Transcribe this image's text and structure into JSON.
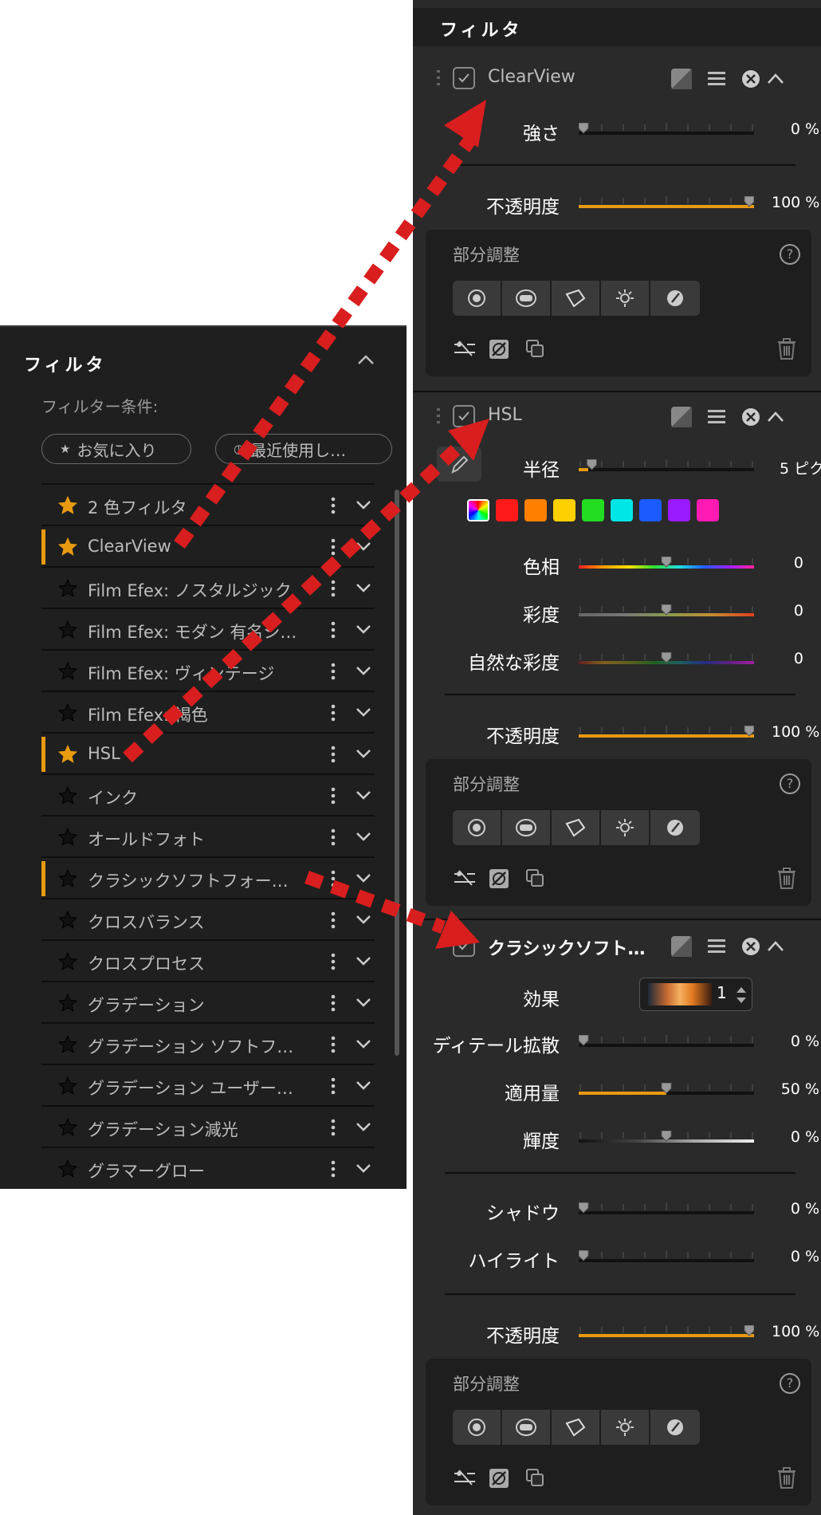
{
  "left": {
    "title": "フィルタ",
    "filter_condition": "フィルター条件:",
    "pill_favorites": "お気に入り",
    "pill_recent": "最近使用し…",
    "items": [
      {
        "label": "2 色フィルタ",
        "fav": true,
        "selected": false
      },
      {
        "label": "ClearView",
        "fav": true,
        "selected": true
      },
      {
        "label": "Film Efex: ノスタルジック",
        "fav": false,
        "selected": false
      },
      {
        "label": "Film Efex: モダン 有名シ…",
        "fav": false,
        "selected": false
      },
      {
        "label": "Film Efex: ヴィンテージ",
        "fav": false,
        "selected": false
      },
      {
        "label": "Film Efex: 褐色",
        "fav": false,
        "selected": false
      },
      {
        "label": "HSL",
        "fav": true,
        "selected": true
      },
      {
        "label": "インク",
        "fav": false,
        "selected": false
      },
      {
        "label": "オールドフォト",
        "fav": false,
        "selected": false
      },
      {
        "label": "クラシックソフトフォー…",
        "fav": false,
        "selected": true
      },
      {
        "label": "クロスバランス",
        "fav": false,
        "selected": false
      },
      {
        "label": "クロスプロセス",
        "fav": false,
        "selected": false
      },
      {
        "label": "グラデーション",
        "fav": false,
        "selected": false
      },
      {
        "label": "グラデーション ソフトフ…",
        "fav": false,
        "selected": false
      },
      {
        "label": "グラデーション ユーザー…",
        "fav": false,
        "selected": false
      },
      {
        "label": "グラデーション減光",
        "fav": false,
        "selected": false
      },
      {
        "label": "グラマーグロー",
        "fav": false,
        "selected": false
      }
    ]
  },
  "right": {
    "title": "フィルタ",
    "clearview": {
      "name": "ClearView",
      "strength_label": "強さ",
      "strength_value": "0 %",
      "strength_level": 0,
      "opacity_label": "不透明度",
      "opacity_value": "100 %",
      "opacity_level": 1.0,
      "local_title": "部分調整",
      "help": "?"
    },
    "hsl": {
      "name": "HSL",
      "radius_label": "半径",
      "radius_value": "5 ピク",
      "radius_level": 0.05,
      "hue_label": "色相",
      "hue_value": "0",
      "sat_label": "彩度",
      "sat_value": "0",
      "vib_label": "自然な彩度",
      "vib_value": "0",
      "opacity_label": "不透明度",
      "opacity_value": "100 %",
      "opacity_level": 1.0,
      "local_title": "部分調整",
      "help": "?",
      "swatches": [
        "rainbow",
        "#ff1a1a",
        "#ff7f00",
        "#ffd000",
        "#22dd22",
        "#00e6e6",
        "#1a5cff",
        "#9a1aff",
        "#ff1ab4"
      ]
    },
    "classic": {
      "name": "クラシックソフト…",
      "effect_label": "効果",
      "effect_value": "1",
      "detail_label": "ディテール拡散",
      "detail_value": "0 %",
      "detail_level": 0,
      "amount_label": "適用量",
      "amount_value": "50 %",
      "amount_level": 0.5,
      "bright_label": "輝度",
      "bright_value": "0 %",
      "shadow_label": "シャドウ",
      "shadow_value": "0 %",
      "highlight_label": "ハイライト",
      "highlight_value": "0 %",
      "opacity_label": "不透明度",
      "opacity_value": "100 %",
      "opacity_level": 1.0,
      "local_title": "部分調整",
      "help": "?"
    }
  },
  "colors": {
    "accent": "#e89a10",
    "arrow": "#d81e1e",
    "panel_bg": "#1f1f1f",
    "panel_bg_right": "#2a2a2a"
  }
}
